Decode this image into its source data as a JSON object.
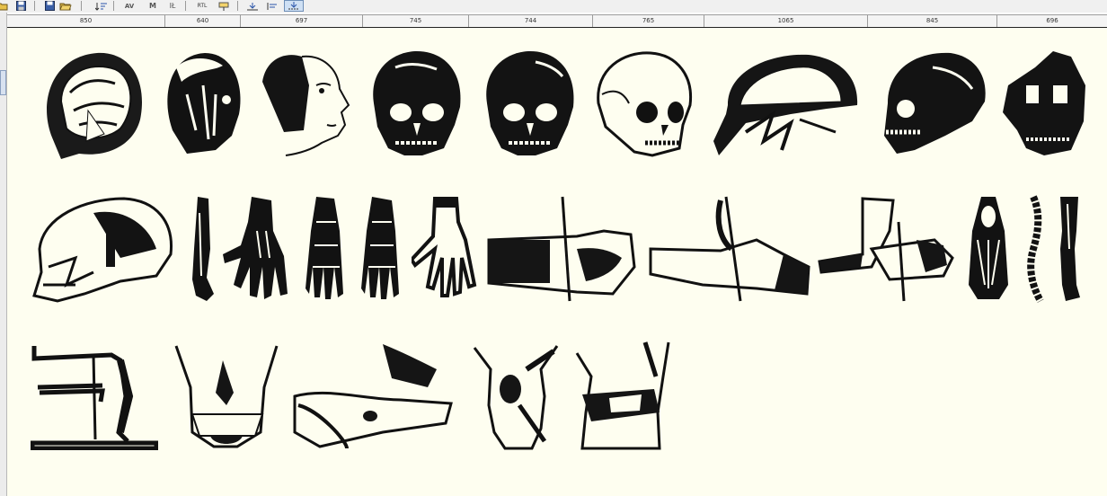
{
  "toolbar": {
    "buttons": [
      {
        "name": "open-icon"
      },
      {
        "name": "save-icon"
      },
      {
        "name": "save-as-icon"
      },
      {
        "name": "open-folder-icon"
      },
      {
        "name": "sort-icon"
      },
      {
        "name": "kerning-icon",
        "label": "AV"
      },
      {
        "name": "metrics-icon",
        "label": "M"
      },
      {
        "name": "height-icon",
        "label": "IŁ"
      },
      {
        "name": "rtl-icon",
        "label": "RTL"
      },
      {
        "name": "insert-icon"
      },
      {
        "name": "align-bottom-icon"
      },
      {
        "name": "align-left-icon"
      },
      {
        "name": "align-baseline-icon"
      }
    ]
  },
  "ruler": {
    "widths": [
      "850",
      "640",
      "697",
      "745",
      "744",
      "765",
      "1065",
      "845",
      "696"
    ]
  },
  "glyphs": {
    "row1": [
      "brain-head",
      "muscle-head",
      "face-profile",
      "skull-front",
      "skull-front-2",
      "skull-three-quarter",
      "skull-cross-section",
      "skull-side",
      "skull-anatomy"
    ],
    "row2": [
      "skull-sagittal",
      "forearm",
      "hand-back",
      "hand-bones",
      "foot-bones",
      "hand-skeleton",
      "arm-surgery-1",
      "arm-surgery-2",
      "arm-surgery-3",
      "foot-sole",
      "spine",
      "leg"
    ],
    "row3": [
      "skeleton-stand",
      "pelvis-surgery",
      "reclining-figure",
      "torso-surgery",
      "abdomen-surgery"
    ]
  }
}
